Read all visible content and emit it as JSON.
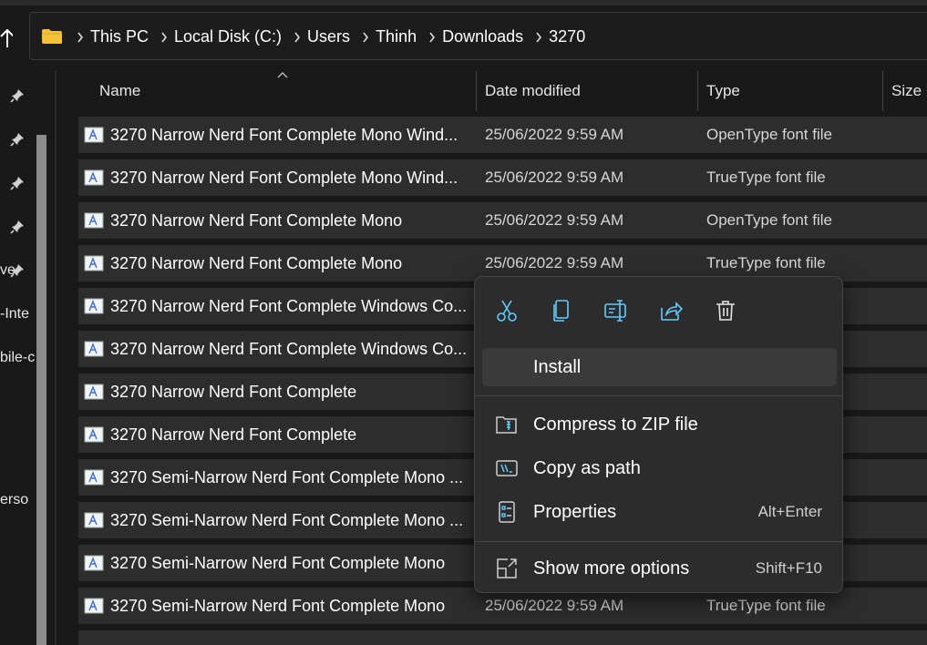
{
  "breadcrumb": [
    "This PC",
    "Local Disk (C:)",
    "Users",
    "Thinh",
    "Downloads",
    "3270"
  ],
  "nav_fragments": [
    "ve",
    "-Inte",
    "bile-c",
    "erso"
  ],
  "columns": {
    "name": "Name",
    "date": "Date modified",
    "type": "Type",
    "size": "Size"
  },
  "files": [
    {
      "name": "3270 Narrow Nerd Font Complete Mono Wind...",
      "date": "25/06/2022 9:59 AM",
      "type": "OpenType font file"
    },
    {
      "name": "3270 Narrow Nerd Font Complete Mono Wind...",
      "date": "25/06/2022 9:59 AM",
      "type": "TrueType font file"
    },
    {
      "name": "3270 Narrow Nerd Font Complete Mono",
      "date": "25/06/2022 9:59 AM",
      "type": "OpenType font file"
    },
    {
      "name": "3270 Narrow Nerd Font Complete Mono",
      "date": "25/06/2022 9:59 AM",
      "type": "TrueType font file"
    },
    {
      "name": "3270 Narrow Nerd Font Complete Windows Co...",
      "date": "",
      "type": ""
    },
    {
      "name": "3270 Narrow Nerd Font Complete Windows Co...",
      "date": "",
      "type": ""
    },
    {
      "name": "3270 Narrow Nerd Font Complete",
      "date": "",
      "type": ""
    },
    {
      "name": "3270 Narrow Nerd Font Complete",
      "date": "",
      "type": ""
    },
    {
      "name": "3270 Semi-Narrow Nerd Font Complete Mono ...",
      "date": "",
      "type": ""
    },
    {
      "name": "3270 Semi-Narrow Nerd Font Complete Mono ...",
      "date": "",
      "type": ""
    },
    {
      "name": "3270 Semi-Narrow Nerd Font Complete Mono",
      "date": "",
      "type": ""
    },
    {
      "name": "3270 Semi-Narrow Nerd Font Complete Mono",
      "date": "25/06/2022 9:59 AM",
      "type": "TrueType font file"
    },
    {
      "name": "",
      "date": "",
      "type": ""
    }
  ],
  "context_menu": {
    "toolbar": [
      "cut-icon",
      "copy-icon",
      "rename-icon",
      "share-icon",
      "delete-icon"
    ],
    "install": "Install",
    "compress": "Compress to ZIP file",
    "copy_path": "Copy as path",
    "properties": "Properties",
    "properties_shortcut": "Alt+Enter",
    "more_options": "Show more options",
    "more_options_shortcut": "Shift+F10"
  },
  "colors": {
    "background": "#191919",
    "row": "#2d2d2d",
    "menu": "#2c2c2c",
    "accent": "#60cdff",
    "folder": "#f3c13a"
  }
}
